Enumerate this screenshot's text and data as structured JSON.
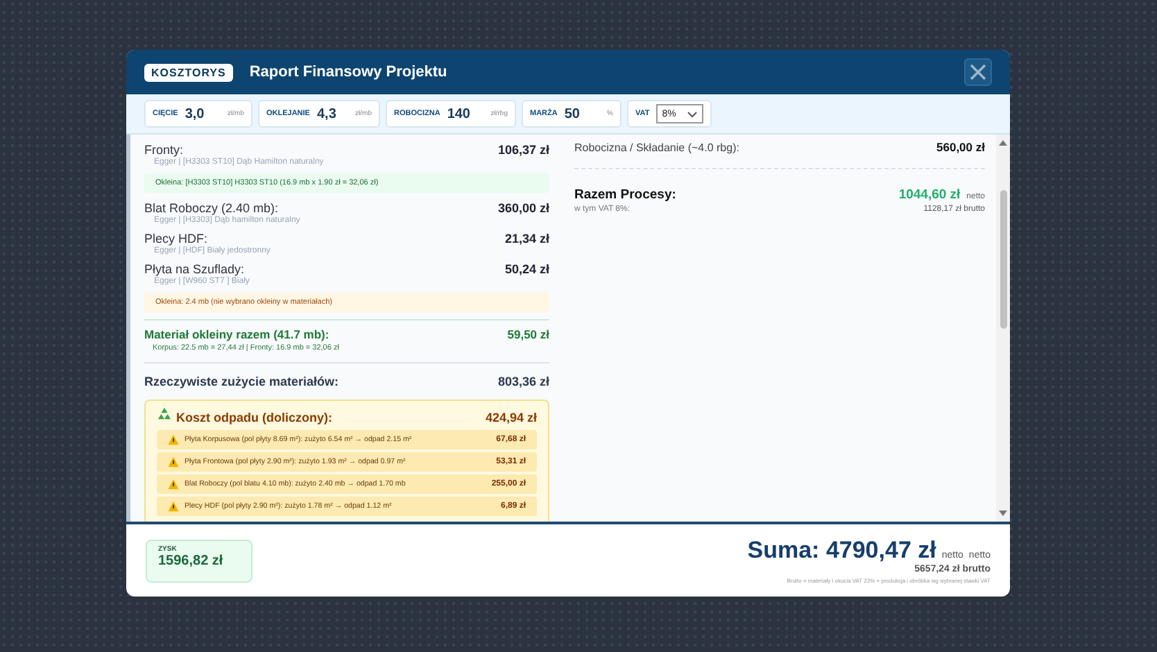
{
  "header": {
    "badge": "KOSZTORYS",
    "title": "Raport Finansowy Projektu"
  },
  "params": [
    {
      "kind": "number",
      "label": "CIĘCIE",
      "value": "3,0",
      "unit": "zł/mb"
    },
    {
      "kind": "number",
      "label": "OKLEJANIE",
      "value": "4,3",
      "unit": "zł/mb"
    },
    {
      "kind": "number",
      "label": "ROBOCIZNA",
      "value": "140",
      "unit": "zł/rbg"
    },
    {
      "kind": "number",
      "label": "MARŻA",
      "value": "50",
      "unit": "%"
    },
    {
      "kind": "select",
      "label": "VAT",
      "value": "8%"
    }
  ],
  "materials": [
    {
      "name": "Fronty:",
      "price": "106,37 zł",
      "detail": "Egger | [H3303 ST10] Dąb Hamilton naturalny",
      "note": {
        "kind": "ok",
        "text": "Okleina: [H3303 ST10] H3303 ST10 (16.9 mb x 1.90 zł = 32,06 zł)"
      }
    },
    {
      "name": "Blat Roboczy (2.40 mb):",
      "price": "360,00 zł",
      "detail": "Egger | [H3303] Dąb hamilton naturalny"
    },
    {
      "name": "Plecy HDF:",
      "price": "21,34 zł",
      "detail": "Egger | [HDF] Biały jedostronny"
    },
    {
      "name": "Płyta na Szuflady:",
      "price": "50,24 zł",
      "detail": "Egger | [W960 ST7 ] Biały",
      "note": {
        "kind": "warn",
        "text": "Okleina: 2.4 mb (nie wybrano okleiny w materiałach)"
      }
    }
  ],
  "veneer_total": {
    "label": "Materiał okleiny razem (41.7 mb):",
    "price": "59,50 zł",
    "detail": "Korpus: 22.5 mb = 27,44 zł | Fronty: 16.9 mb = 32,06 zł"
  },
  "actual_usage": {
    "label": "Rzeczywiste zużycie materiałów:",
    "price": "803,36 zł"
  },
  "waste": {
    "title": "Koszt odpadu (doliczony):",
    "price": "424,94 zł",
    "items": [
      {
        "text": "Płyta Korpusowa (pol płyty 8.69 m²): zużyto 6.54 m² → odpad 2.15 m²",
        "price": "67,68 zł"
      },
      {
        "text": "Płyta Frontowa (pol płyty 2.90 m²): zużyto 1.93 m² → odpad 0.97 m²",
        "price": "53,31 zł"
      },
      {
        "text": "Blat Roboczy (pol blatu 4.10 mb): zużyto 2.40 mb → odpad 1.70 mb",
        "price": "255,00 zł"
      },
      {
        "text": "Plecy HDF (pol płyty 2.90 m²): zużyto 1.78 m² → odpad 1.12 m²",
        "price": "6,89 zł"
      }
    ]
  },
  "processes": [
    {
      "label": "Robocizna / Składanie (~4.0 rbg):",
      "price": "560,00 zł"
    }
  ],
  "process_total": {
    "label": "Razem Procesy:",
    "price": "1044,60 zł",
    "unit": "netto",
    "vat_label": "w tym VAT 8%:",
    "brutto": "1128,17 zł brutto"
  },
  "footer": {
    "profit_label": "ZYSK",
    "profit": "1596,82 zł",
    "sum": "Suma: 4790,47 zł",
    "netto": "netto",
    "netto2": "netto",
    "brutto": "5657,24 zł brutto",
    "note": "Brutto = materiały i okucia VAT 23% + produkcja i obróbka wg wybranej stawki VAT"
  }
}
